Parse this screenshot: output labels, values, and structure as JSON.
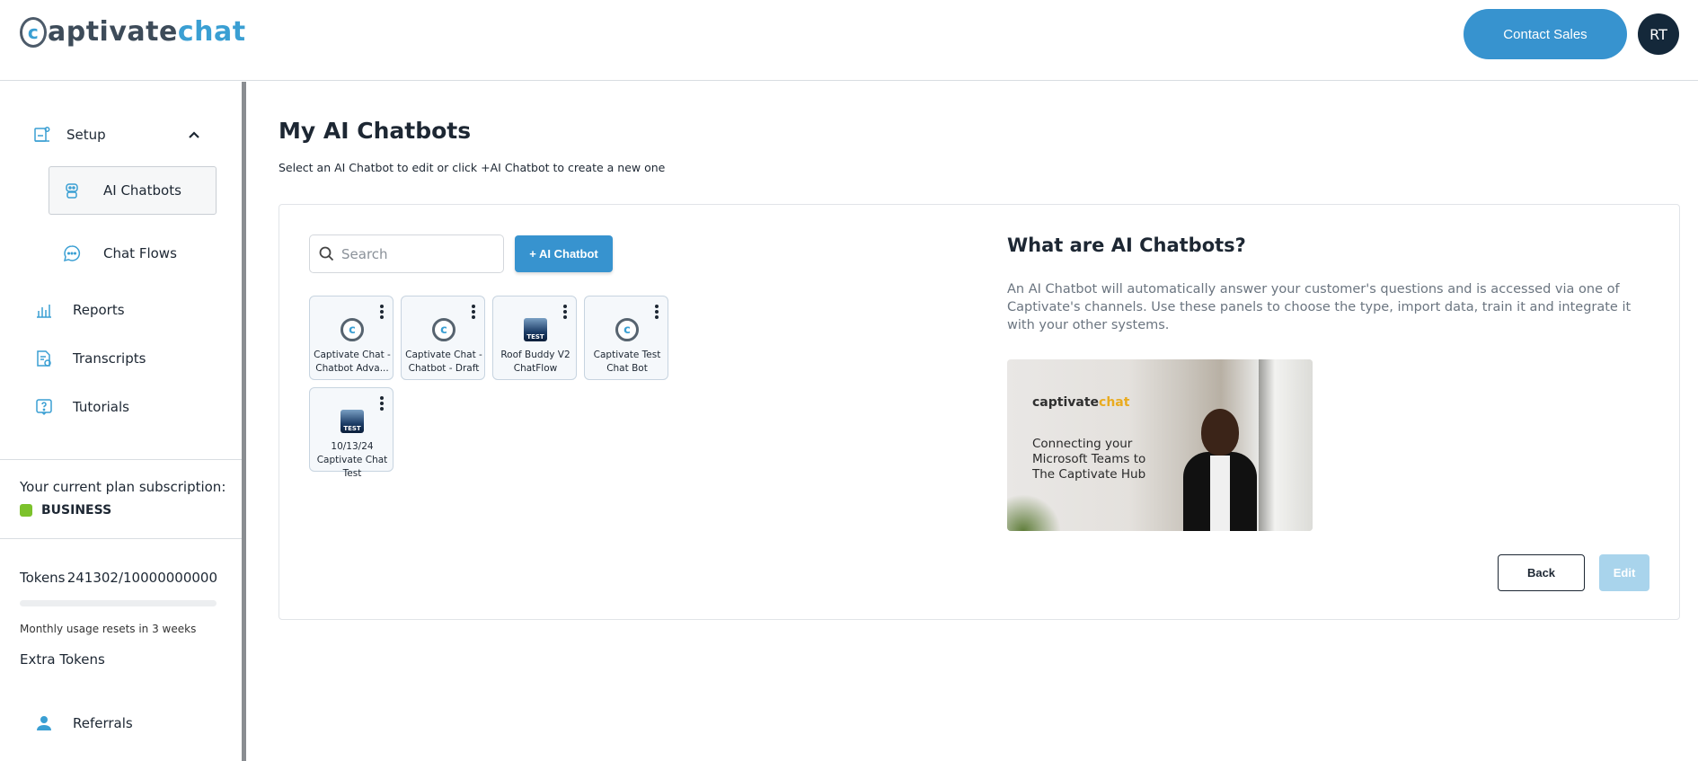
{
  "header": {
    "logo_part1": "aptivate",
    "logo_part2": "chat",
    "logo_mark": "c",
    "contact_label": "Contact Sales",
    "avatar_initials": "RT"
  },
  "sidebar": {
    "setup_label": "Setup",
    "items": [
      {
        "label": "AI Chatbots",
        "icon": "robot-icon",
        "selected": true
      },
      {
        "label": "Chat Flows",
        "icon": "chat-bubble-icon"
      },
      {
        "label": "Reports",
        "icon": "bar-chart-icon"
      },
      {
        "label": "Transcripts",
        "icon": "document-icon"
      },
      {
        "label": "Tutorials",
        "icon": "help-icon"
      }
    ],
    "plan_label": "Your current plan subscription:",
    "plan_name": "BUSINESS",
    "plan_color": "#7cc22c",
    "tokens_label": "Tokens",
    "tokens_value": "241302/10000000000",
    "tokens_used_fraction": 2.41e-05,
    "reset_text": "Monthly usage resets in 3 weeks",
    "extra_tokens_label": "Extra Tokens",
    "referrals_label": "Referrals"
  },
  "main": {
    "title": "My AI Chatbots",
    "subtitle": "Select an AI Chatbot to edit or click +AI Chatbot to create a new one",
    "search_placeholder": "Search",
    "add_button_label": "+ AI Chatbot",
    "bots": [
      {
        "name": "Captivate Chat - Chatbot Adva...",
        "image": "captivate-logo"
      },
      {
        "name": "Captivate Chat - Chatbot - Draft",
        "image": "captivate-logo"
      },
      {
        "name": "Roof Buddy V2 ChatFlow",
        "image": "test-image"
      },
      {
        "name": "Captivate Test Chat Bot",
        "image": "captivate-logo"
      },
      {
        "name": "10/13/24 Captivate Chat Test",
        "image": "test-image"
      }
    ],
    "test_image_text": "TEST",
    "info_title": "What are AI Chatbots?",
    "info_description": "An AI Chatbot will automatically answer your customer's questions and is accessed via one of Captivate's channels. Use these panels to choose the type, import data, train it and integrate it with your other systems.",
    "video": {
      "logo_text": "captivate",
      "logo_accent": "chat",
      "caption": "Connecting your Microsoft Teams to The Captivate Hub"
    },
    "back_label": "Back",
    "edit_label": "Edit"
  },
  "colors": {
    "accent": "#3793cf",
    "avatar_bg": "#14283a",
    "edit_disabled": "#a9d4ec"
  }
}
